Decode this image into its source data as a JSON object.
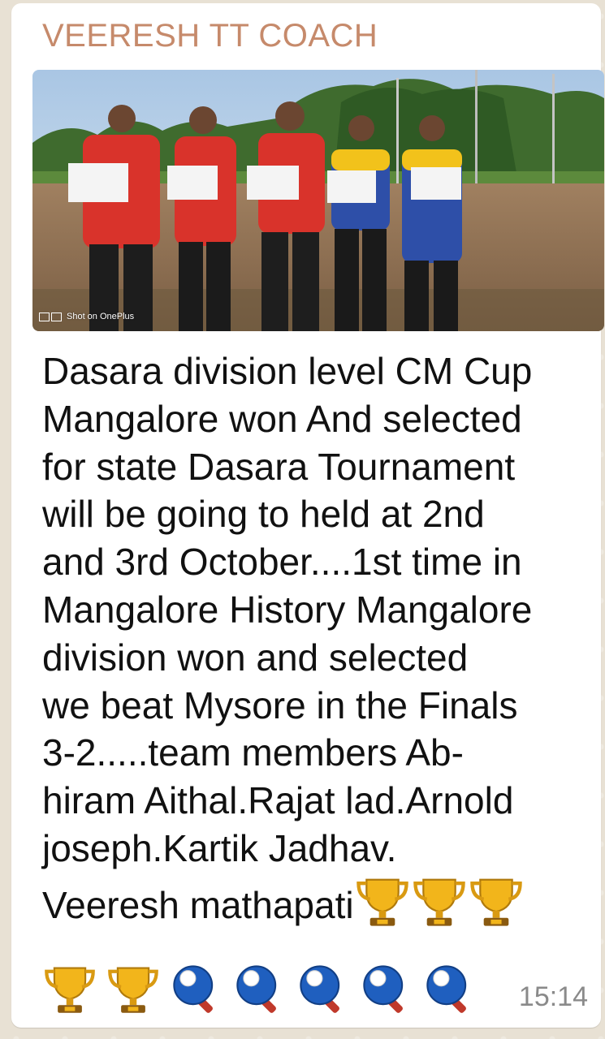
{
  "chat": {
    "sender_name": "VEERESH TT COACH",
    "photo": {
      "watermark_text": "Shot on OnePlus",
      "watermark_icon": "camera-frame-icon"
    },
    "message_lines": [
      "Dasara division level CM Cup",
      "Mangalore won And selected",
      "for state Dasara Tournament",
      "will be going to held at 2nd",
      "and 3rd October....1st time in",
      "Mangalore History Mangalore",
      "division won and selected",
      "we beat Mysore in the Finals",
      "3-2.....team members Ab-",
      "hiram Aithal.Rajat lad.Arnold",
      "joseph.Kartik Jadhav.",
      "Veeresh mathapati"
    ],
    "emojis_inline": [
      "trophy",
      "trophy",
      "trophy"
    ],
    "emojis_last_row": [
      "trophy",
      "trophy",
      "ping-pong",
      "ping-pong",
      "ping-pong",
      "ping-pong",
      "ping-pong"
    ],
    "timestamp": "15:14"
  },
  "colors": {
    "sender": "#c68a6b",
    "bubble": "#ffffff",
    "wallpaper": "#e8e1d4",
    "timestamp": "#8a8a8a"
  }
}
